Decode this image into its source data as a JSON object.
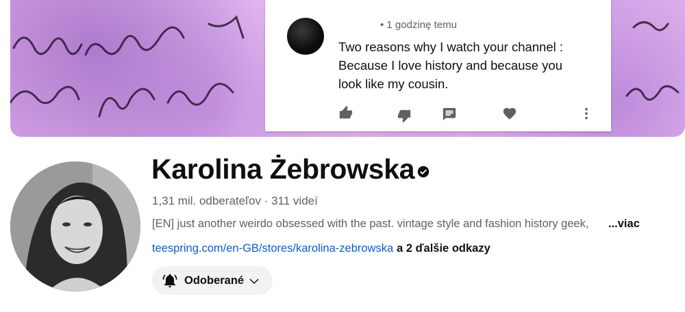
{
  "banner": {
    "comment": {
      "time": "• 1 godzinę temu",
      "text": "Two reasons why I watch your channel : Because I love history and because you look like my cousin.",
      "icons": [
        "thumb-up-icon",
        "thumb-down-icon",
        "reply-icon",
        "heart-icon",
        "more-vert-icon"
      ]
    }
  },
  "channel": {
    "name": "Karolina Żebrowska",
    "stats": "1,31 mil. odberateľov · 311 videí",
    "description": "[EN] just another weirdo obsessed with the past. vintage style and fashion history geek,",
    "more_label": "...viac",
    "link_text": "teespring.com/en-GB/stores/karolina-zebrowska",
    "extra_links": "a 2 ďalšie odkazy",
    "subscribe_label": "Odoberané"
  },
  "colors": {
    "link": "#065fd4",
    "secondary_text": "#606060",
    "banner_purple": "#d9a8e8"
  }
}
